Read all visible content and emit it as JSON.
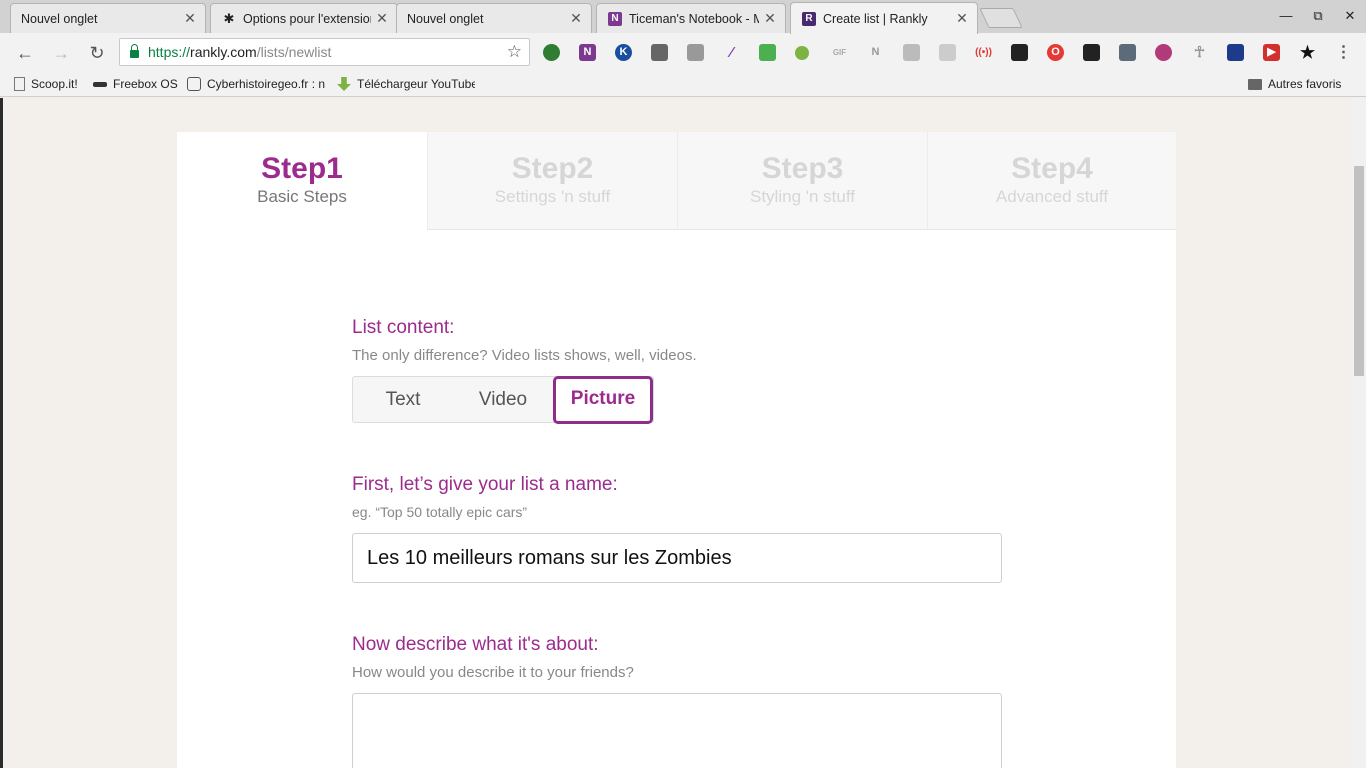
{
  "browser": {
    "tabs": [
      {
        "title": "Nouvel onglet",
        "favicon": "none"
      },
      {
        "title": "Options pour l'extension",
        "favicon": "star-icon"
      },
      {
        "title": "Nouvel onglet",
        "favicon": "none"
      },
      {
        "title": "Ticeman's Notebook - M",
        "favicon": "onenote-icon"
      },
      {
        "title": "Create list | Rankly",
        "favicon": "rankly-icon",
        "active": true
      }
    ],
    "window_controls": {
      "minimize": "—",
      "restore": "⧉",
      "close": "✕"
    },
    "address": {
      "scheme": "https://",
      "host": "rankly.com",
      "path": "/lists/newlist"
    },
    "bookmarks": [
      {
        "label": "Scoop.it!",
        "icon": "page-icon"
      },
      {
        "label": "Freebox OS",
        "icon": "freebox-icon"
      },
      {
        "label": "Cyberhistoiregeo.fr : n",
        "icon": "owl-icon"
      },
      {
        "label": "Téléchargeur YouTube",
        "icon": "download-arrow-icon"
      }
    ],
    "other_bookmarks": "Autres favoris"
  },
  "steps": [
    {
      "num": "Step1",
      "sub": "Basic Steps",
      "active": true
    },
    {
      "num": "Step2",
      "sub": "Settings 'n stuff"
    },
    {
      "num": "Step3",
      "sub": "Styling 'n stuff"
    },
    {
      "num": "Step4",
      "sub": "Advanced stuff"
    }
  ],
  "form": {
    "content": {
      "title": "List content:",
      "hint": "The only difference? Video lists shows, well, videos.",
      "options": [
        "Text",
        "Video",
        "Picture"
      ],
      "selected": "Picture"
    },
    "name": {
      "title": "First, let’s give your list a name:",
      "hint": "eg. “Top 50 totally epic cars”",
      "value": "Les 10 meilleurs romans sur les Zombies"
    },
    "description": {
      "title": "Now describe what it's about:",
      "hint": "How would you describe it to your friends?",
      "value": ""
    }
  },
  "colors": {
    "accent": "#9c2b8e",
    "inactive_step": "#d6d6d6",
    "page_bg": "#f3efea"
  }
}
